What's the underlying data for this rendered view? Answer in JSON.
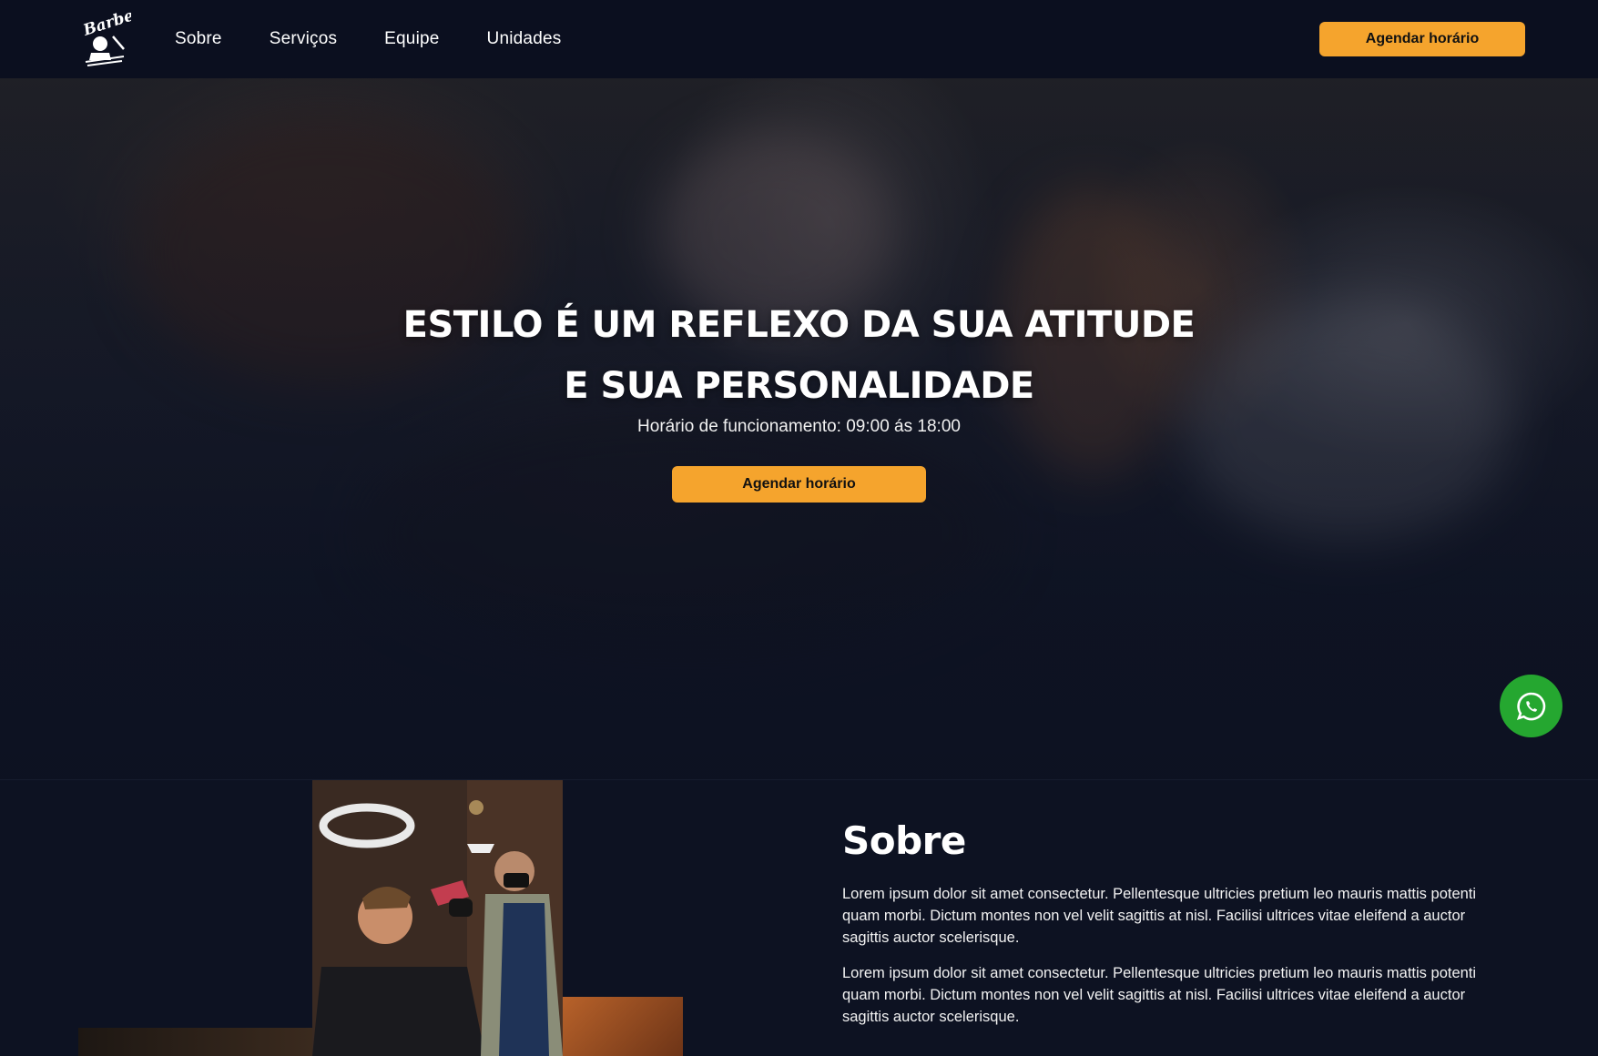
{
  "navbar": {
    "logo_text": "Barber",
    "links": [
      "Sobre",
      "Serviços",
      "Equipe",
      "Unidades"
    ],
    "cta_label": "Agendar horário"
  },
  "hero": {
    "title": "ESTILO É UM REFLEXO DA SUA ATITUDE E SUA PERSONALIDADE",
    "subtitle": "Horário de funcionamento: 09:00 ás 18:00",
    "cta_label": "Agendar horário"
  },
  "whatsapp": {
    "icon": "whatsapp-icon",
    "color": "#25a730"
  },
  "about": {
    "title": "Sobre",
    "paragraphs": [
      "Lorem ipsum dolor sit amet consectetur. Pellentesque ultricies pretium leo mauris mattis potenti quam morbi. Dictum montes non vel velit sagittis at nisl. Facilisi ultrices vitae eleifend a auctor sagittis auctor scelerisque.",
      "Lorem ipsum dolor sit amet consectetur. Pellentesque ultricies pretium leo mauris mattis potenti quam morbi. Dictum montes non vel velit sagittis at nisl. Facilisi ultrices vitae eleifend a auctor sagittis auctor scelerisque."
    ]
  },
  "colors": {
    "accent": "#f5a42d",
    "navbar_bg": "#0b0f1f",
    "page_bg": "#0c1120",
    "whatsapp_green": "#25a730"
  }
}
